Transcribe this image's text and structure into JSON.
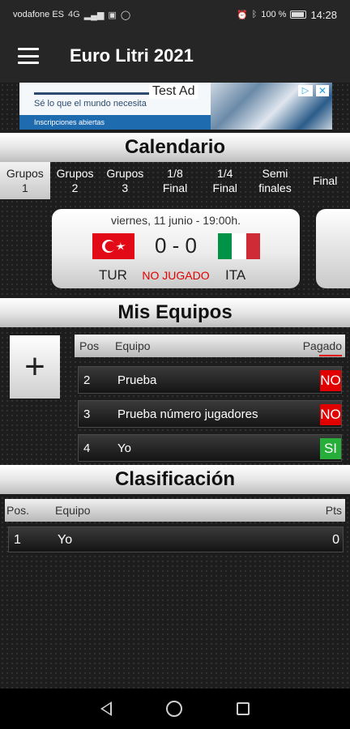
{
  "status_bar": {
    "carrier": "vodafone ES",
    "network": "4G",
    "battery": "100 %",
    "time": "14:28",
    "icons": [
      "signal-icon",
      "no-sim-icon",
      "whatsapp-icon",
      "alarm-icon",
      "bluetooth-icon",
      "battery-icon"
    ]
  },
  "app_bar": {
    "title": "Euro Litri 2021",
    "menu_icon": "hamburger-menu-icon"
  },
  "ad": {
    "label": "Test Ad",
    "line1": "Sé lo que el mundo necesita",
    "line2": "Inscripciones abiertas",
    "choices_icon": "ad-choices-icon",
    "close_icon": "close-icon"
  },
  "calendar": {
    "header": "Calendario",
    "rounds": [
      {
        "line1": "Grupos",
        "line2": "1",
        "selected": true
      },
      {
        "line1": "Grupos",
        "line2": "2",
        "selected": false
      },
      {
        "line1": "Grupos",
        "line2": "3",
        "selected": false
      },
      {
        "line1": "1/8",
        "line2": "Final",
        "selected": false
      },
      {
        "line1": "1/4",
        "line2": "Final",
        "selected": false
      },
      {
        "line1": "Semi",
        "line2": "finales",
        "selected": false
      },
      {
        "line1": "Final",
        "line2": "",
        "selected": false
      }
    ],
    "match": {
      "date": "viernes, 11 junio - 19:00h.",
      "home_team": "TUR",
      "away_team": "ITA",
      "score": "0 - 0",
      "status": "NO JUGADO",
      "home_flag_colors": [
        "#e30a17",
        "#ffffff"
      ],
      "away_flag_colors": [
        "#009246",
        "#ffffff",
        "#ce2b37"
      ]
    }
  },
  "my_teams": {
    "header": "Mis Equipos",
    "add_label": "+",
    "columns": {
      "pos": "Pos",
      "team": "Equipo",
      "paid": "Pagado"
    },
    "rows": [
      {
        "pos": "2",
        "team": "Prueba",
        "paid": "NO",
        "paid_color": "#e10000"
      },
      {
        "pos": "3",
        "team": "Prueba número jugadores",
        "paid": "NO",
        "paid_color": "#e10000"
      },
      {
        "pos": "4",
        "team": "Yo",
        "paid": "SI",
        "paid_color": "#27ae3a"
      }
    ]
  },
  "classification": {
    "header": "Clasificación",
    "columns": {
      "pos": "Pos.",
      "team": "Equipo",
      "pts": "Pts"
    },
    "rows": [
      {
        "pos": "1",
        "team": "Yo",
        "pts": "0"
      }
    ]
  },
  "nav_bar": {
    "icons": [
      "back-icon",
      "home-icon",
      "recent-apps-icon"
    ]
  }
}
